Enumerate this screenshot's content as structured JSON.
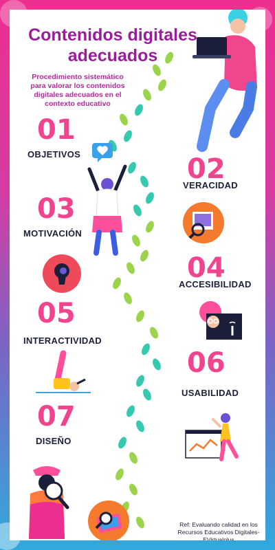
{
  "header": {
    "title": "Contenidos digitales adecuados",
    "subtitle": "Procedimiento sistemático para valorar los contenidos digitales adecuados en el contexto educativo"
  },
  "steps": [
    {
      "number": "01",
      "label": "OBJETIVOS"
    },
    {
      "number": "02",
      "label": "VERACIDAD"
    },
    {
      "number": "03",
      "label": "MOTIVACIÓN"
    },
    {
      "number": "04",
      "label": "ACCESIBILIDAD"
    },
    {
      "number": "05",
      "label": "INTERACTIVIDAD"
    },
    {
      "number": "06",
      "label": "USABILIDAD"
    },
    {
      "number": "07",
      "label": "DISEÑO"
    }
  ],
  "footer": {
    "reference": "Ref: Evaluando calidad en los Recursos Educativos Digitales-EVirtualplus"
  },
  "colors": {
    "accent_pink": "#f0448f",
    "title_purple": "#9a1d9b",
    "label_navy": "#1b1f3a",
    "footprint_green": "#9bd44a",
    "footprint_teal": "#35c9b0"
  },
  "icons": [
    "laptop-person-illustration",
    "heart-speech-bubble-icon",
    "cheering-person-illustration",
    "photo-magnifier-icon",
    "keyhole-icon",
    "person-touchscreen-icon",
    "upside-down-person-illustration",
    "chart-person-illustration",
    "detective-person-illustration",
    "magnifier-card-icon",
    "footprints-trail"
  ]
}
